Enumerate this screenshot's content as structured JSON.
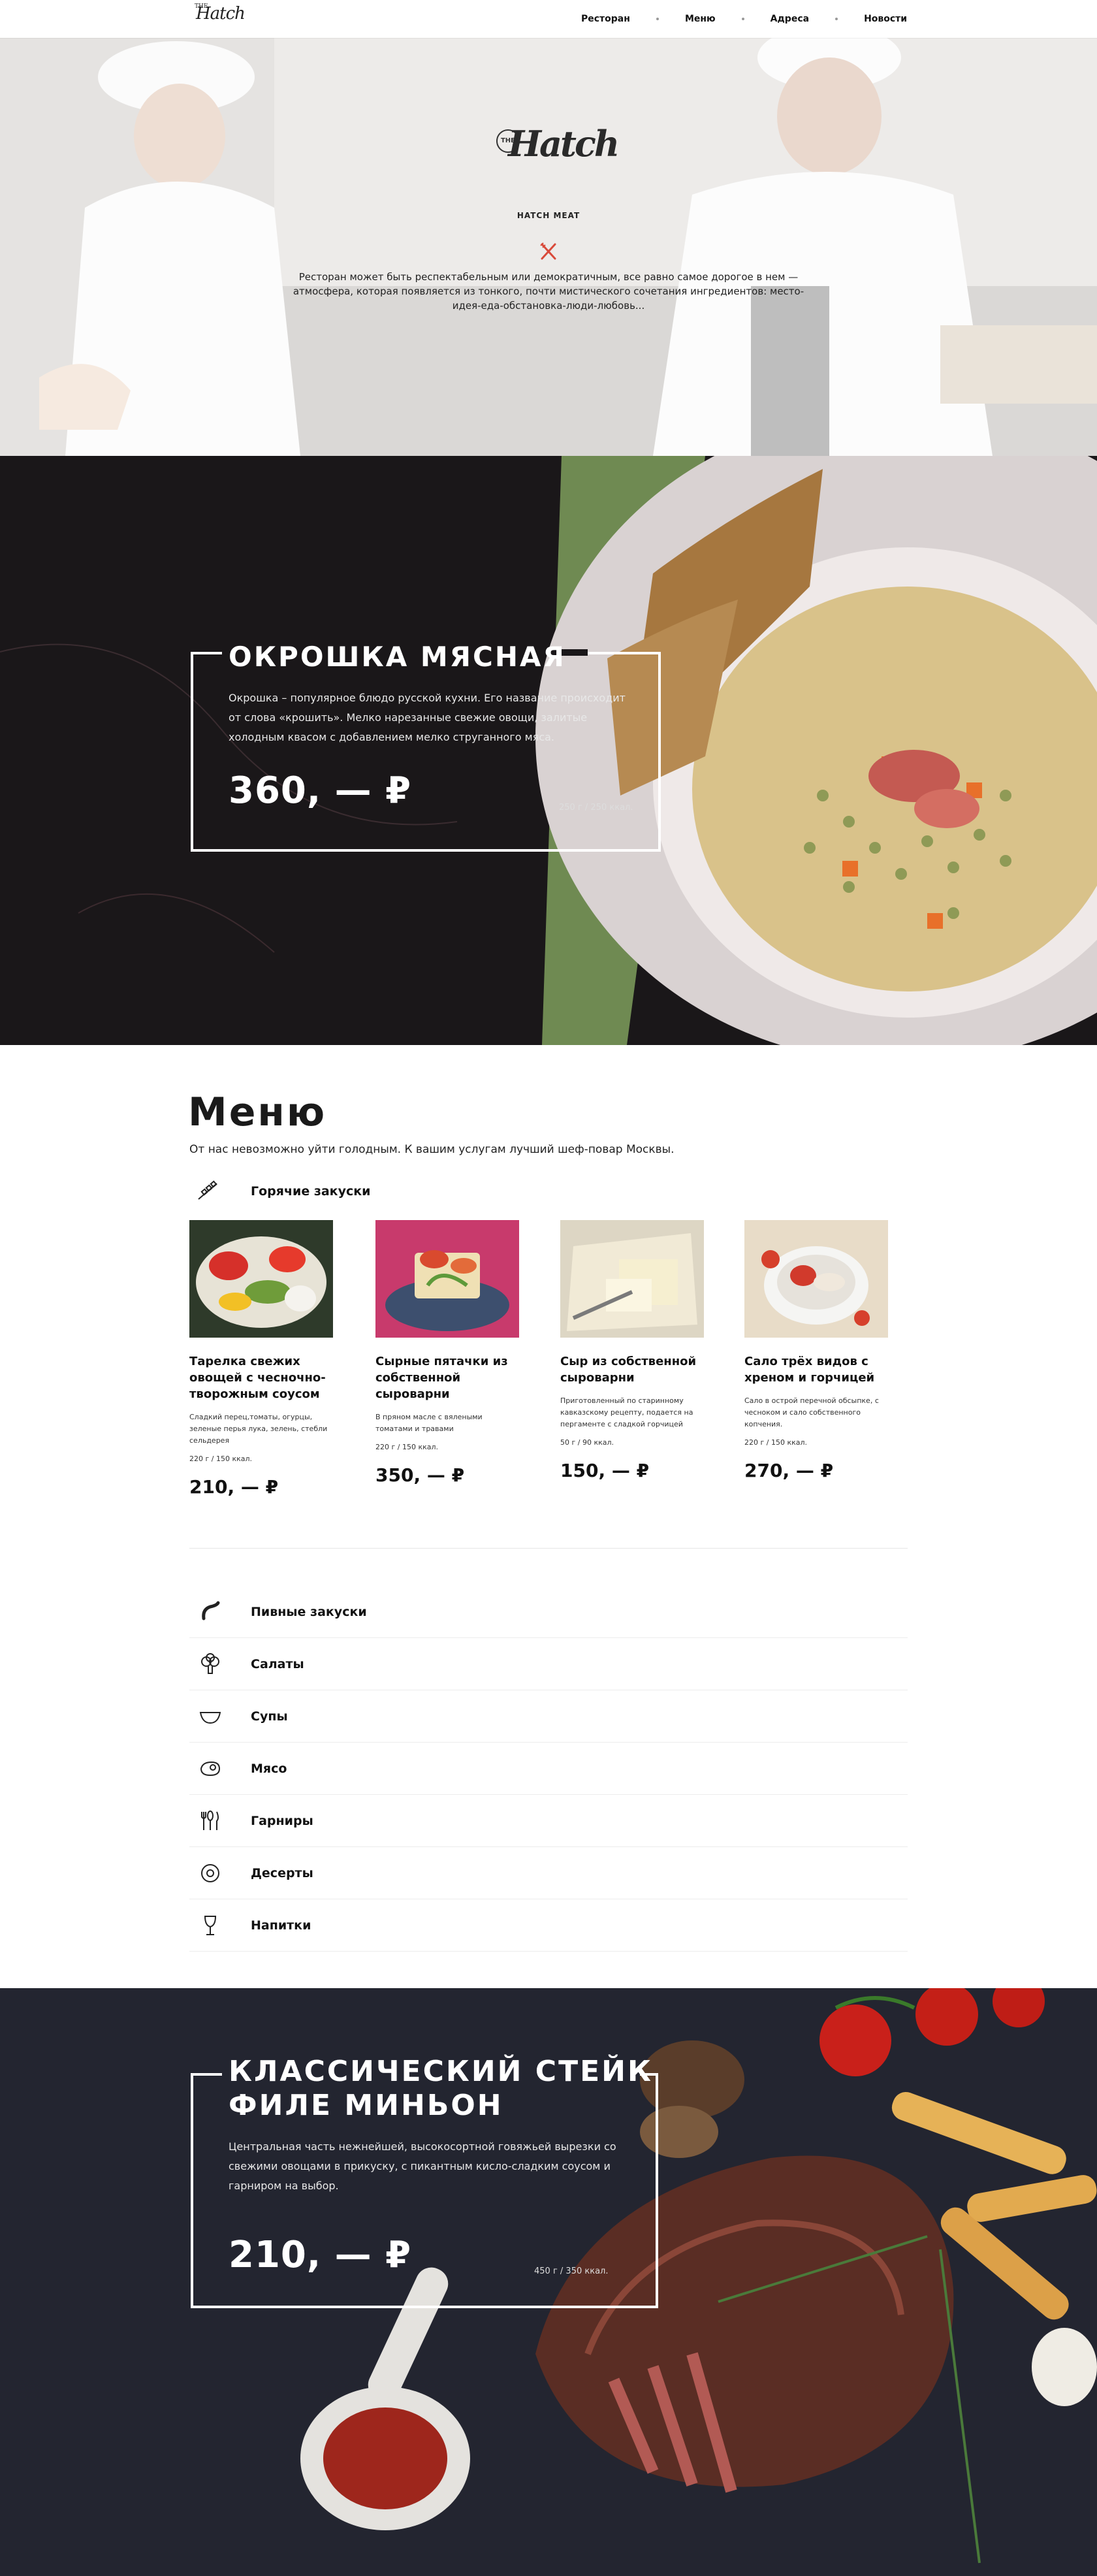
{
  "header": {
    "logo": "Hatch",
    "logo_prefix": "THE",
    "nav": [
      "Ресторан",
      "Меню",
      "Адреса",
      "Новости"
    ]
  },
  "hero": {
    "logo_prefix": "THE",
    "logo": "Hatch",
    "subtitle": "HATCH MEAT",
    "icon": "fork-knife-icon",
    "text": "Ресторан может быть респектабельным или демократичным, все равно самое дорогое в нем — атмосфера, которая появляется из тонкого, почти мистического сочетания ингредиентов: место-идея-еда-обстановка-люди-любовь..."
  },
  "feature_okroshka": {
    "title": "Окрошка мясная",
    "description": "Окрошка – популярное блюдо русской кухни. Его название происходит от слова «крошить». Мелко нарезанные свежие овощи, залитые холодным квасом с добавлением мелко струганного мяса.",
    "price": "360, — ₽",
    "weight": "250 г / 250 ккал."
  },
  "menu": {
    "title": "Меню",
    "lead": "От нас невозможно уйти голодным. К вашим услугам лучший шеф-повар Москвы.",
    "active_category": {
      "label": "Горячие закуски",
      "icon": "skewer-icon"
    },
    "items": [
      {
        "name": "Тарелка свежих овощей с чесночно-творожным соусом",
        "description": "Сладкий перец,томаты, огурцы, зеленые перья лука, зелень, стебли сельдерея",
        "weight": "220 г / 150 ккал.",
        "price": "210, — ₽"
      },
      {
        "name": "Сырные пятачки из собственной сыроварни",
        "description": "В пряном масле с вялеными томатами и травами",
        "weight": "220 г / 150 ккал.",
        "price": "350, — ₽"
      },
      {
        "name": "Сыр из собственной сыроварни",
        "description": "Приготовленный по старинному кавказскому рецепту, подается на пергаменте с сладкой горчицей",
        "weight": "50 г  / 90 ккал.",
        "price": "150, — ₽"
      },
      {
        "name": "Сало трёх видов с хреном и горчицей",
        "description": "Сало в острой перечной обсыпке, с чесноком и сало собственного копчения.",
        "weight": "220 г / 150 ккал.",
        "price": "270, — ₽"
      }
    ],
    "categories": [
      {
        "label": "Пивные закуски",
        "icon": "sausage-icon"
      },
      {
        "label": "Салаты",
        "icon": "broccoli-icon"
      },
      {
        "label": "Супы",
        "icon": "bowl-icon"
      },
      {
        "label": "Мясо",
        "icon": "steak-icon"
      },
      {
        "label": "Гарниры",
        "icon": "cutlery-icon"
      },
      {
        "label": "Десерты",
        "icon": "donut-icon"
      },
      {
        "label": "Напитки",
        "icon": "wine-glass-icon"
      }
    ]
  },
  "feature_steak": {
    "title_line1": "Классический стейк",
    "title_line2": "филе миньон",
    "description": "Центральная часть нежнейшей, высокосортной говяжьей вырезки со свежими овощами в прикуску, с пикантным кисло-сладким соусом и гарниром на выбор.",
    "price": "210, — ₽",
    "weight": "450 г / 350 ккал."
  },
  "colors": {
    "dark_feature": "#1a1719",
    "steak_bg": "#232530",
    "text": "#1a1a1a",
    "white": "#ffffff"
  }
}
